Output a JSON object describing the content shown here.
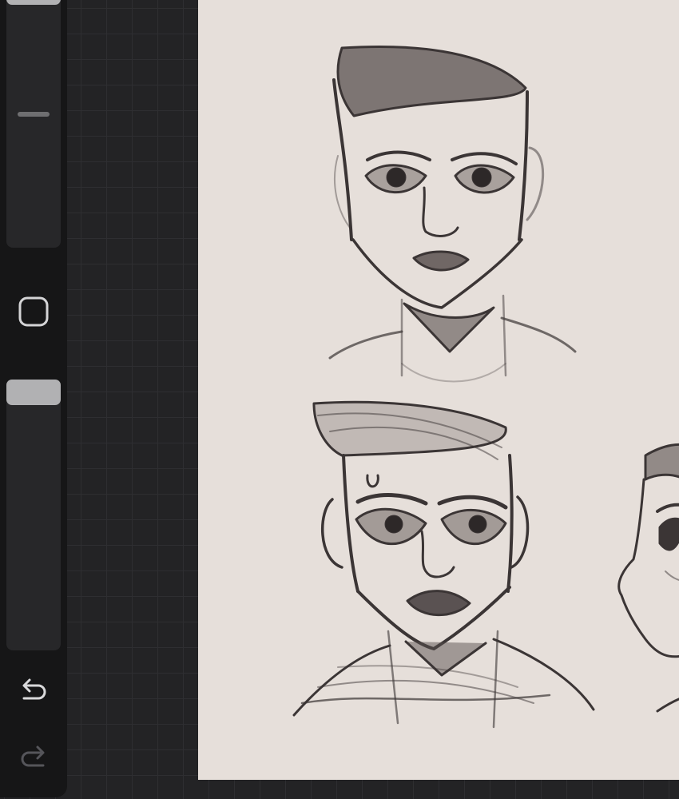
{
  "app": {
    "canvas_color": "#e6dfda",
    "sidebar_color": "#161617",
    "workspace_color": "#232325"
  },
  "sidebar": {
    "brush_size_slider": {
      "icon": "slider-thumb",
      "level": 0.0
    },
    "modify_button": {
      "icon": "square-outline-icon"
    },
    "opacity_slider": {
      "icon": "slider-thumb",
      "level": 1.0
    },
    "undo_button": {
      "icon": "undo-arrow-icon"
    },
    "redo_button": {
      "icon": "redo-arrow-icon",
      "enabled": false
    }
  },
  "canvas": {
    "content": [
      "sketch-head-front",
      "sketch-head-mustache",
      "sketch-head-profile-partial"
    ],
    "stroke_color": "#3b3535"
  }
}
